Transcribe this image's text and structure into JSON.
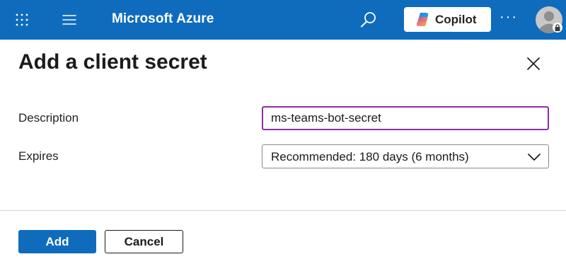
{
  "header": {
    "brand": "Microsoft Azure",
    "copilot_label": "Copilot",
    "more_label": "···",
    "bar_color": "#0f6cbd",
    "icons": {
      "app_launcher": "waffle-icon",
      "menu": "hamburger-icon",
      "search": "search-icon",
      "copilot": "copilot-icon",
      "account": "avatar-icon"
    }
  },
  "panel": {
    "title": "Add a client secret",
    "close_icon": "close-icon"
  },
  "form": {
    "description": {
      "label": "Description",
      "value": "ms-teams-bot-secret"
    },
    "expires": {
      "label": "Expires",
      "selected": "Recommended: 180 days (6 months)"
    }
  },
  "actions": {
    "add_label": "Add",
    "cancel_label": "Cancel",
    "primary_color": "#0f6cbd"
  }
}
